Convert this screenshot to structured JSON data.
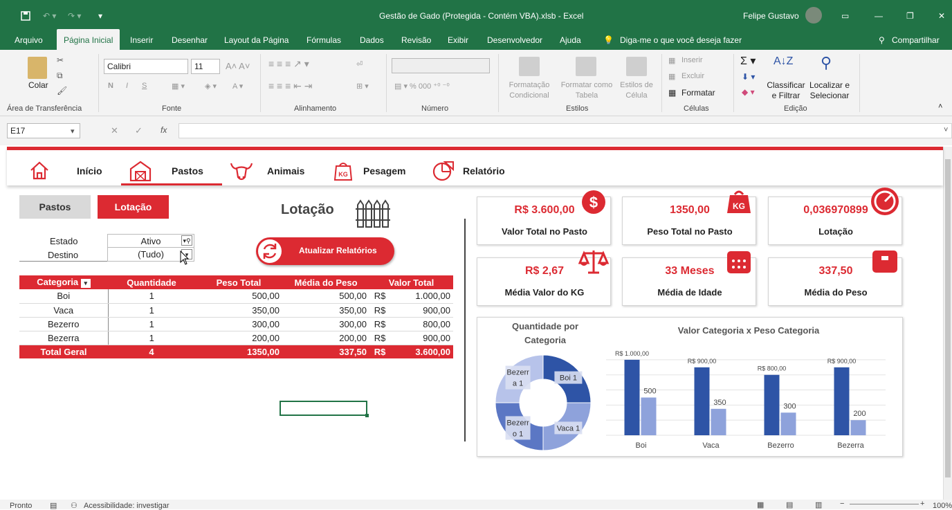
{
  "window": {
    "title": "Gestão de Gado (Protegida - Contém VBA).xlsb  -  Excel",
    "user": "Felipe Gustavo"
  },
  "tabs": [
    "Arquivo",
    "Página Inicial",
    "Inserir",
    "Desenhar",
    "Layout da Página",
    "Fórmulas",
    "Dados",
    "Revisão",
    "Exibir",
    "Desenvolvedor",
    "Ajuda"
  ],
  "tell_me": "Diga-me o que você deseja fazer",
  "share": "Compartilhar",
  "ribbon": {
    "paste": "Colar",
    "font_name": "Calibri",
    "font_size": "11",
    "font_btns": [
      "N",
      "I",
      "S"
    ],
    "styles": {
      "cond": "Formatação Condicional",
      "table": "Formatar como Tabela",
      "cell": "Estilos de Célula"
    },
    "cells": {
      "insert": "Inserir",
      "delete": "Excluir",
      "format": "Formatar"
    },
    "edit": {
      "sort": "Classificar e Filtrar",
      "find": "Localizar e Selecionar"
    },
    "groups": [
      "Área de Transferência",
      "Fonte",
      "Alinhamento",
      "Número",
      "Estilos",
      "Células",
      "Edição"
    ]
  },
  "formula_bar": {
    "name_box": "E17",
    "fx": "fx",
    "value": ""
  },
  "nav": {
    "items": [
      "Início",
      "Pastos",
      "Animais",
      "Pesagem",
      "Relatório"
    ]
  },
  "sub_buttons": {
    "pastos": "Pastos",
    "lotacao": "Lotação"
  },
  "section_title": "Lotação",
  "update_button": "Atualizar Relatórios",
  "filters": [
    {
      "label": "Estado",
      "value": "Ativo"
    },
    {
      "label": "Destino",
      "value": "(Tudo)"
    }
  ],
  "pivot": {
    "headers": [
      "Categoria",
      "Quantidade",
      "Peso Total",
      "Média do Peso",
      "Valor Total"
    ],
    "rows": [
      {
        "cat": "Boi",
        "qtd": "1",
        "peso": "500,00",
        "media": "500,00",
        "cur": "R$",
        "valor": "1.000,00"
      },
      {
        "cat": "Vaca",
        "qtd": "1",
        "peso": "350,00",
        "media": "350,00",
        "cur": "R$",
        "valor": "900,00"
      },
      {
        "cat": "Bezerro",
        "qtd": "1",
        "peso": "300,00",
        "media": "300,00",
        "cur": "R$",
        "valor": "800,00"
      },
      {
        "cat": "Bezerra",
        "qtd": "1",
        "peso": "200,00",
        "media": "200,00",
        "cur": "R$",
        "valor": "900,00"
      }
    ],
    "total": {
      "cat": "Total Geral",
      "qtd": "4",
      "peso": "1350,00",
      "media": "337,50",
      "cur": "R$",
      "valor": "3.600,00"
    }
  },
  "cards": [
    {
      "value": "R$ 3.600,00",
      "label": "Valor Total no Pasto",
      "icon": "dollar-icon"
    },
    {
      "value": "1350,00",
      "label": "Peso Total no Pasto",
      "icon": "kg-weight-icon"
    },
    {
      "value": "0,036970899",
      "label": "Lotação",
      "icon": "gauge-icon"
    },
    {
      "value": "R$ 2,67",
      "label": "Média Valor do KG",
      "icon": "scale-icon"
    },
    {
      "value": "33 Meses",
      "label": "Média de Idade",
      "icon": "calendar-icon"
    },
    {
      "value": "337,50",
      "label": "Média do Peso",
      "icon": "scale-box-icon"
    }
  ],
  "colors": {
    "accent": "#dc2a32",
    "excel_green": "#217346",
    "dark_bar": "#2e54a6",
    "light_bar": "#8ea2db"
  },
  "status": {
    "ready": "Pronto",
    "accessibility": "Acessibilidade: investigar",
    "zoom": "100%"
  },
  "chart_data": [
    {
      "type": "pie",
      "title": "Quantidade por Categoria",
      "categories": [
        "Boi",
        "Vaca",
        "Bezerro",
        "Bezerra"
      ],
      "values": [
        1,
        1,
        1,
        1
      ],
      "labels": [
        "Boi 1",
        "Vaca 1",
        "Bezerr o 1",
        "Bezerr a 1"
      ]
    },
    {
      "type": "bar",
      "title": "Valor Categoria x Peso Categoria",
      "categories": [
        "Boi",
        "Vaca",
        "Bezerro",
        "Bezerra"
      ],
      "series": [
        {
          "values": [
            1000,
            900,
            800,
            900
          ],
          "labels": [
            "R$ 1.000,00",
            "R$ 900,00",
            "R$ 800,00",
            "R$ 900,00"
          ]
        },
        {
          "values": [
            500,
            350,
            300,
            200
          ],
          "labels": [
            "500",
            "350",
            "300",
            "200"
          ]
        }
      ],
      "grid": true
    }
  ]
}
